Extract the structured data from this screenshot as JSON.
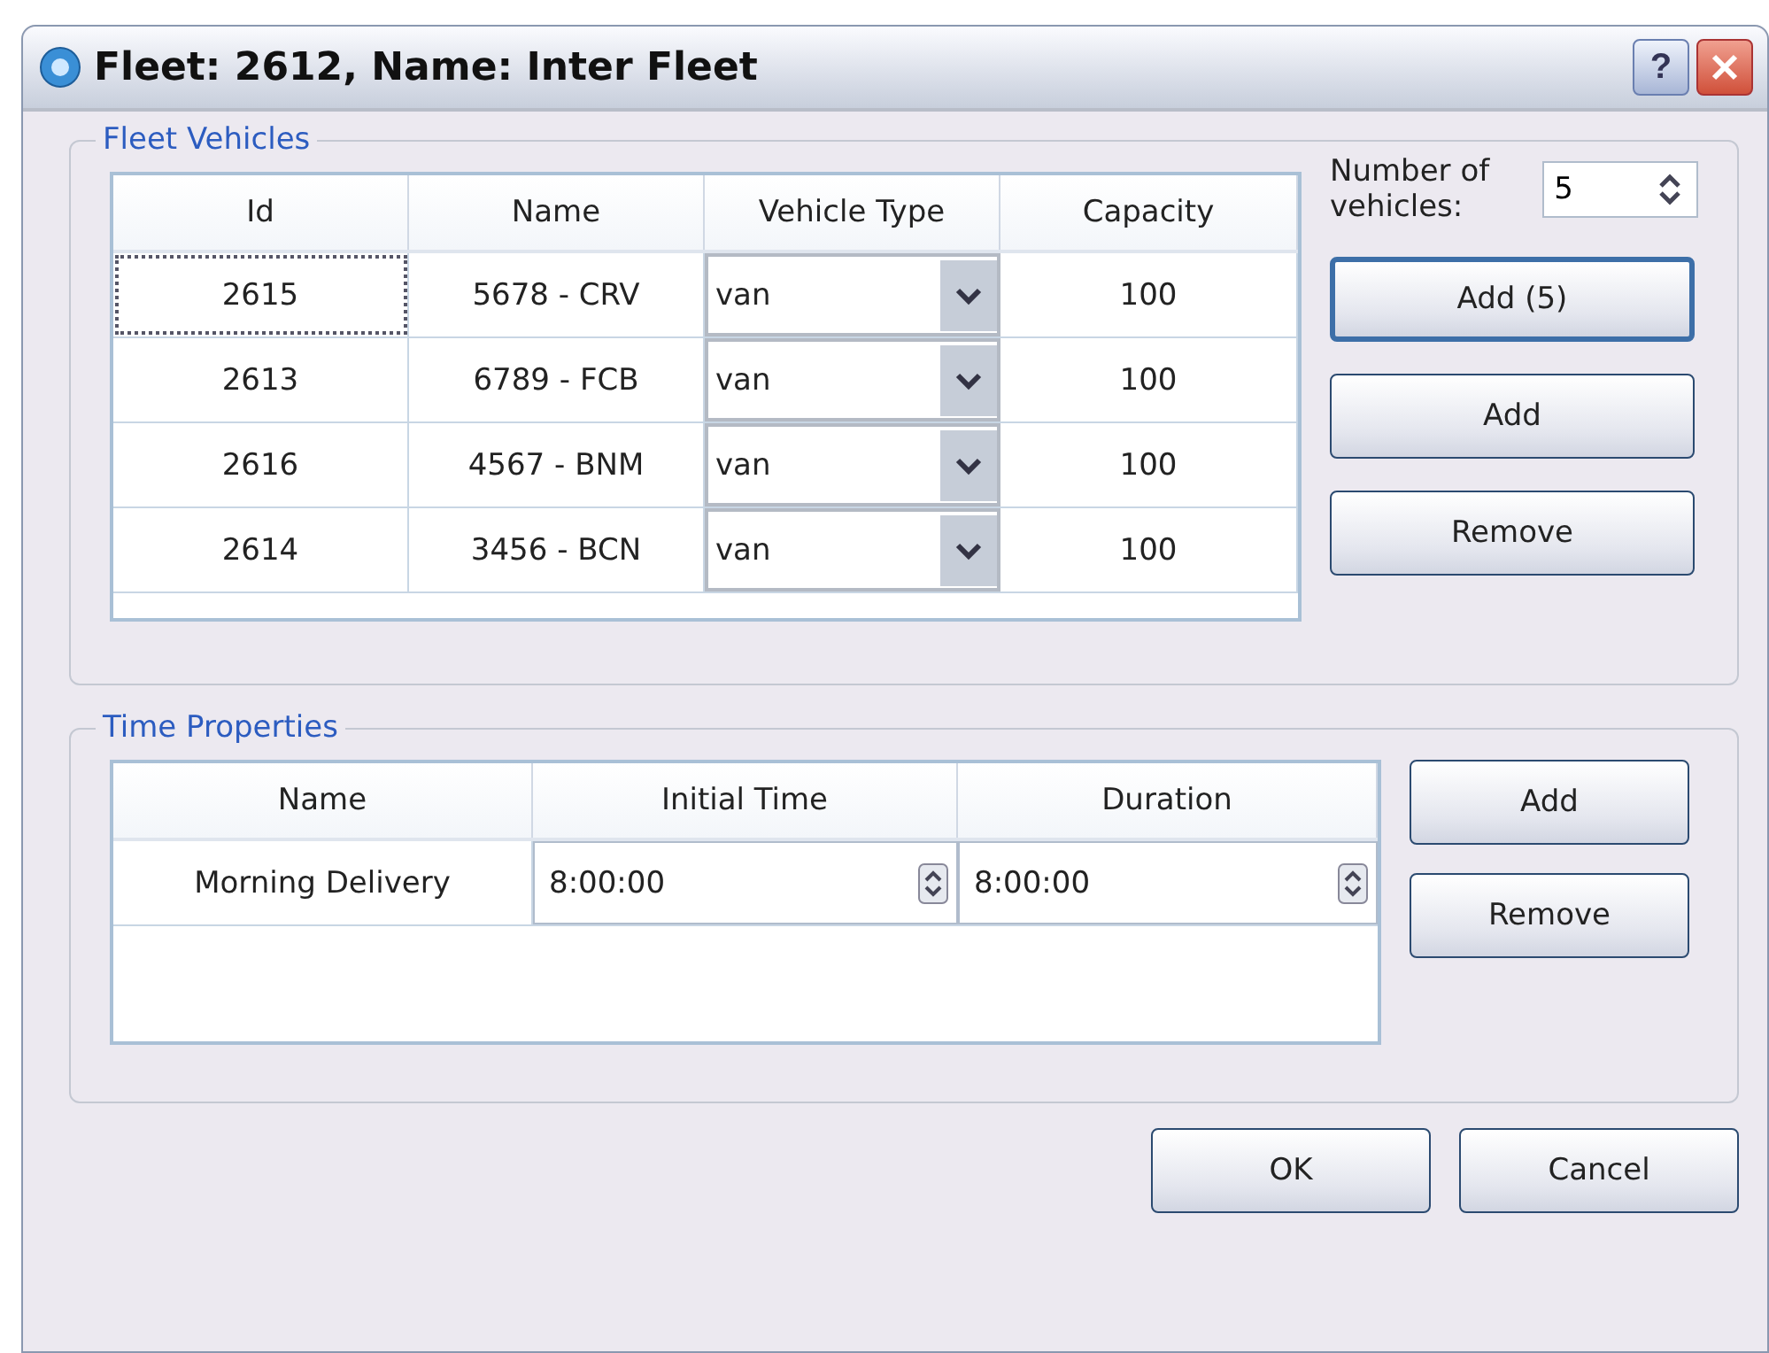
{
  "window": {
    "title": "Fleet: 2612, Name: Inter Fleet",
    "help": "?"
  },
  "fleet_vehicles": {
    "title": "Fleet Vehicles",
    "columns": [
      "Id",
      "Name",
      "Vehicle Type",
      "Capacity"
    ],
    "rows": [
      {
        "id": "2615",
        "name": "5678 - CRV",
        "vehicle_type": "van",
        "capacity": "100",
        "selected": true
      },
      {
        "id": "2613",
        "name": "6789 - FCB",
        "vehicle_type": "van",
        "capacity": "100",
        "selected": false
      },
      {
        "id": "2616",
        "name": "4567 - BNM",
        "vehicle_type": "van",
        "capacity": "100",
        "selected": false
      },
      {
        "id": "2614",
        "name": "3456 - BCN",
        "vehicle_type": "van",
        "capacity": "100",
        "selected": false
      }
    ],
    "number_label": "Number of vehicles:",
    "number_value": "5",
    "buttons": [
      {
        "label": "Add (5)",
        "default": true
      },
      {
        "label": "Add",
        "default": false
      },
      {
        "label": "Remove",
        "default": false
      }
    ]
  },
  "time_properties": {
    "title": "Time Properties",
    "columns": [
      "Name",
      "Initial Time",
      "Duration"
    ],
    "rows": [
      {
        "name": "Morning Delivery",
        "initial_time": "8:00:00",
        "duration": "8:00:00"
      }
    ],
    "buttons": [
      "Add",
      "Remove"
    ]
  },
  "footer_buttons": [
    "OK",
    "Cancel"
  ]
}
